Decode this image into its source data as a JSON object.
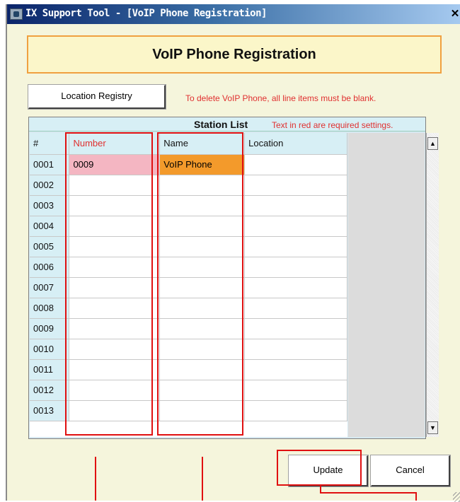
{
  "window": {
    "title": "IX Support Tool - [VoIP Phone Registration]",
    "close_glyph": "✕"
  },
  "header": {
    "title": "VoIP Phone Registration"
  },
  "toolbar": {
    "location_registry_label": "Location Registry",
    "delete_notice": "To delete VoIP Phone, all line items must be blank."
  },
  "station_list": {
    "title": "Station List",
    "required_note": "Text in red are required settings.",
    "columns": [
      "#",
      "Number",
      "Name",
      "Location"
    ],
    "rows": [
      {
        "index": "0001",
        "number": "0009",
        "name": "VoIP Phone",
        "location": ""
      },
      {
        "index": "0002",
        "number": "",
        "name": "",
        "location": ""
      },
      {
        "index": "0003",
        "number": "",
        "name": "",
        "location": ""
      },
      {
        "index": "0004",
        "number": "",
        "name": "",
        "location": ""
      },
      {
        "index": "0005",
        "number": "",
        "name": "",
        "location": ""
      },
      {
        "index": "0006",
        "number": "",
        "name": "",
        "location": ""
      },
      {
        "index": "0007",
        "number": "",
        "name": "",
        "location": ""
      },
      {
        "index": "0008",
        "number": "",
        "name": "",
        "location": ""
      },
      {
        "index": "0009",
        "number": "",
        "name": "",
        "location": ""
      },
      {
        "index": "0010",
        "number": "",
        "name": "",
        "location": ""
      },
      {
        "index": "0011",
        "number": "",
        "name": "",
        "location": ""
      },
      {
        "index": "0012",
        "number": "",
        "name": "",
        "location": ""
      },
      {
        "index": "0013",
        "number": "",
        "name": "",
        "location": ""
      }
    ]
  },
  "footer": {
    "update_label": "Update",
    "cancel_label": "Cancel"
  },
  "colors": {
    "required_text": "#e03030",
    "highlight_box": "#e01010",
    "number_filled_bg": "#f4b6c2",
    "name_filled_bg": "#f39a2b",
    "header_border": "#f0a040"
  },
  "icons": {
    "app": "app-icon",
    "close": "close-icon",
    "scroll_up": "scroll-up-arrow-icon",
    "scroll_down": "scroll-down-arrow-icon",
    "resize": "resize-grip-icon"
  }
}
